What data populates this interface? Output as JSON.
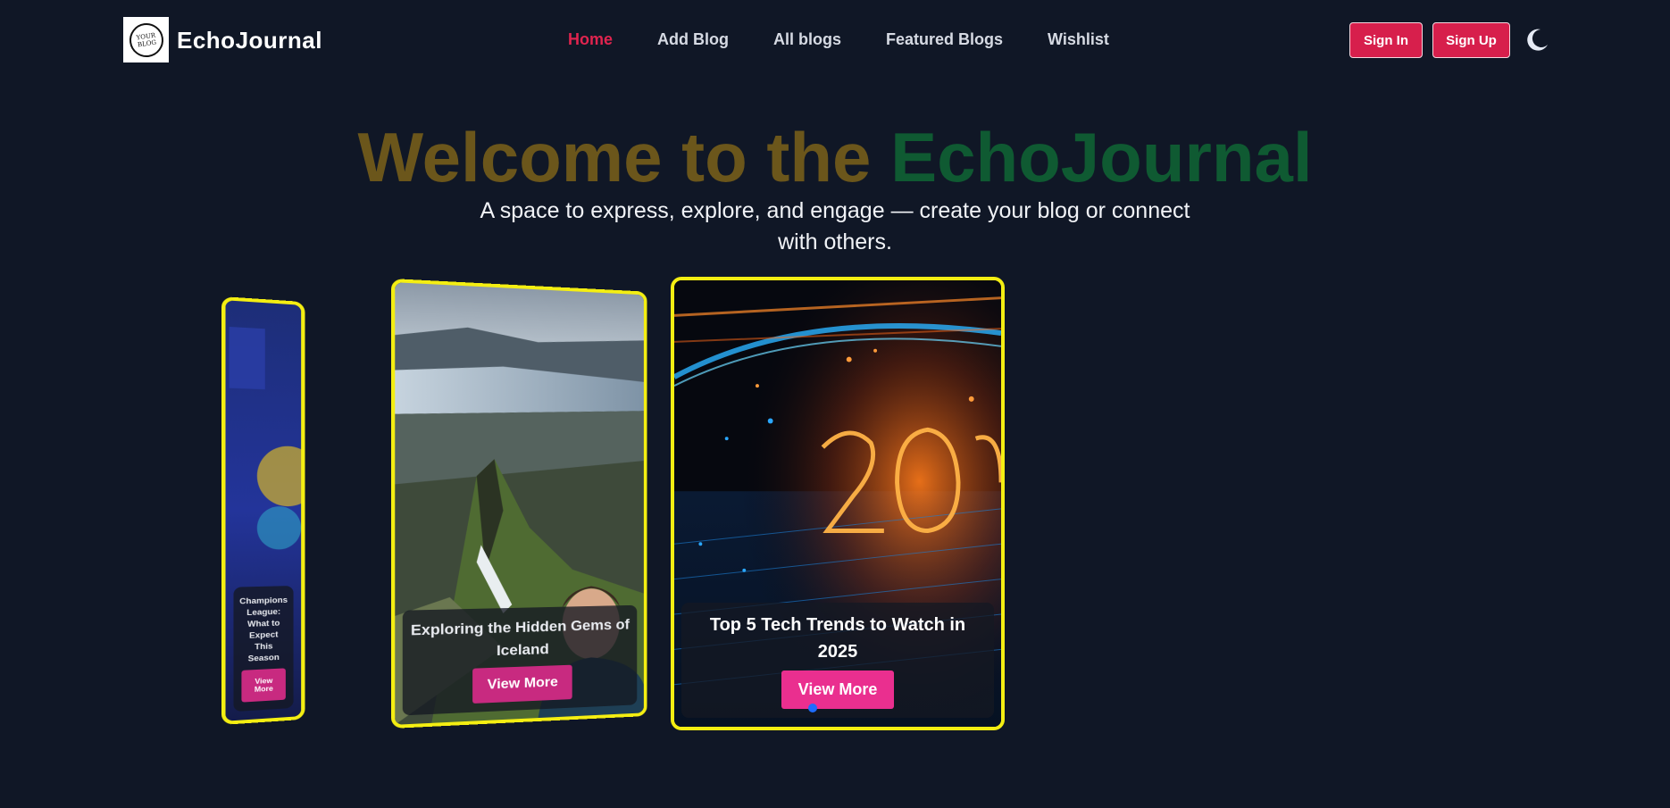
{
  "brand": {
    "name": "EchoJournal",
    "logo_text": "YOUR BLOG"
  },
  "nav": {
    "items": [
      {
        "label": "Home"
      },
      {
        "label": "Add Blog"
      },
      {
        "label": "All blogs"
      },
      {
        "label": "Featured Blogs"
      },
      {
        "label": "Wishlist"
      }
    ],
    "active_index": 0,
    "sign_in": "Sign In",
    "sign_up": "Sign Up",
    "theme_icon": "moon-icon"
  },
  "hero": {
    "title_part1": "Welcome to the ",
    "title_part2": "EchoJournal",
    "subtitle": "A space to express, explore, and engage — create your blog or connect with others."
  },
  "carousel": {
    "cards": [
      {
        "title": "Champions League: What to Expect This Season",
        "button": "View More"
      },
      {
        "title": "Exploring the Hidden Gems of Iceland",
        "button": "View More"
      },
      {
        "title": "Top 5 Tech Trends to Watch in 2025",
        "button": "View More"
      }
    ],
    "active_index": 2
  },
  "colors": {
    "background": "#101726",
    "accent": "#e0244f",
    "button": "#d71f4c",
    "view_more": "#ea2f8f",
    "card_border": "#f4ee12",
    "title_gold": "#6b561b",
    "title_green": "#0f5a32"
  }
}
